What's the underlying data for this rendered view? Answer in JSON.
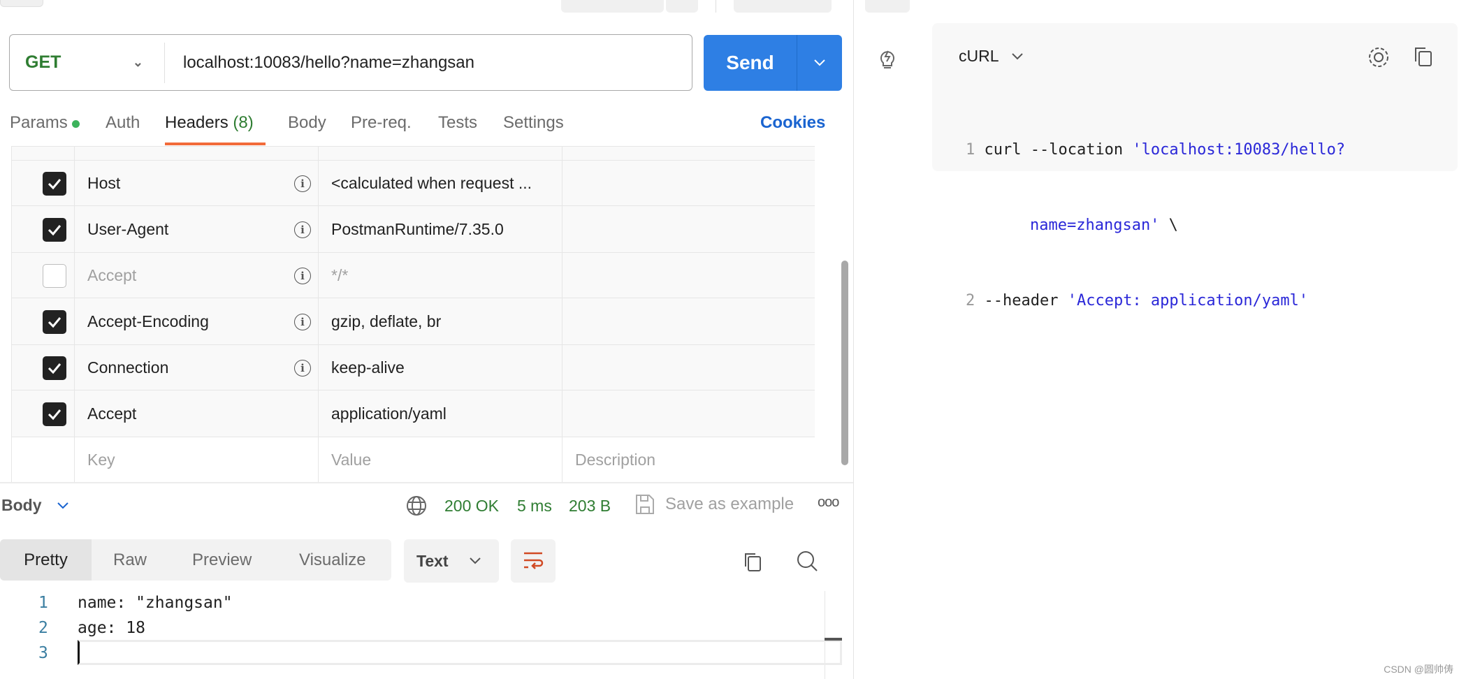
{
  "request": {
    "method": "GET",
    "url": "localhost:10083/hello?name=zhangsan",
    "send_label": "Send"
  },
  "tabs": {
    "params": "Params",
    "auth": "Auth",
    "headers": "Headers",
    "headers_count": "(8)",
    "body": "Body",
    "prereq": "Pre-req.",
    "tests": "Tests",
    "settings": "Settings",
    "cookies": "Cookies"
  },
  "headers": [
    {
      "checked": true,
      "key": "Host",
      "value": "<calculated when request ...",
      "info": true
    },
    {
      "checked": true,
      "key": "User-Agent",
      "value": "PostmanRuntime/7.35.0",
      "info": true
    },
    {
      "checked": false,
      "key": "Accept",
      "value": "*/*",
      "info": true
    },
    {
      "checked": true,
      "key": "Accept-Encoding",
      "value": "gzip, deflate, br",
      "info": true
    },
    {
      "checked": true,
      "key": "Connection",
      "value": "keep-alive",
      "info": true
    },
    {
      "checked": true,
      "key": "Accept",
      "value": "application/yaml",
      "info": false
    }
  ],
  "placeholders": {
    "key": "Key",
    "value": "Value",
    "description": "Description"
  },
  "response": {
    "label": "Body",
    "status": "200 OK",
    "time": "5 ms",
    "size": "203 B",
    "save": "Save as example",
    "views": [
      "Pretty",
      "Raw",
      "Preview",
      "Visualize"
    ],
    "format": "Text",
    "lines": [
      {
        "n": "1",
        "t": "name: \"zhangsan\""
      },
      {
        "n": "2",
        "t": "age: 18"
      },
      {
        "n": "3",
        "t": ""
      }
    ]
  },
  "snippet": {
    "language": "cURL",
    "lines": [
      {
        "n": "1",
        "a": "curl --location ",
        "b": "'localhost:10083/hello?"
      },
      {
        "n": "",
        "a": "",
        "b": "name=zhangsan'",
        "c": " \\"
      },
      {
        "n": "2",
        "a": "--header ",
        "b": "'Accept: application/yaml'"
      }
    ]
  },
  "watermark": "CSDN @圆帅俦",
  "colors": {
    "accent": "#2e7fe4",
    "success": "#2f7d32",
    "tab_underline": "#f26b3a",
    "string": "#2a27d8"
  }
}
